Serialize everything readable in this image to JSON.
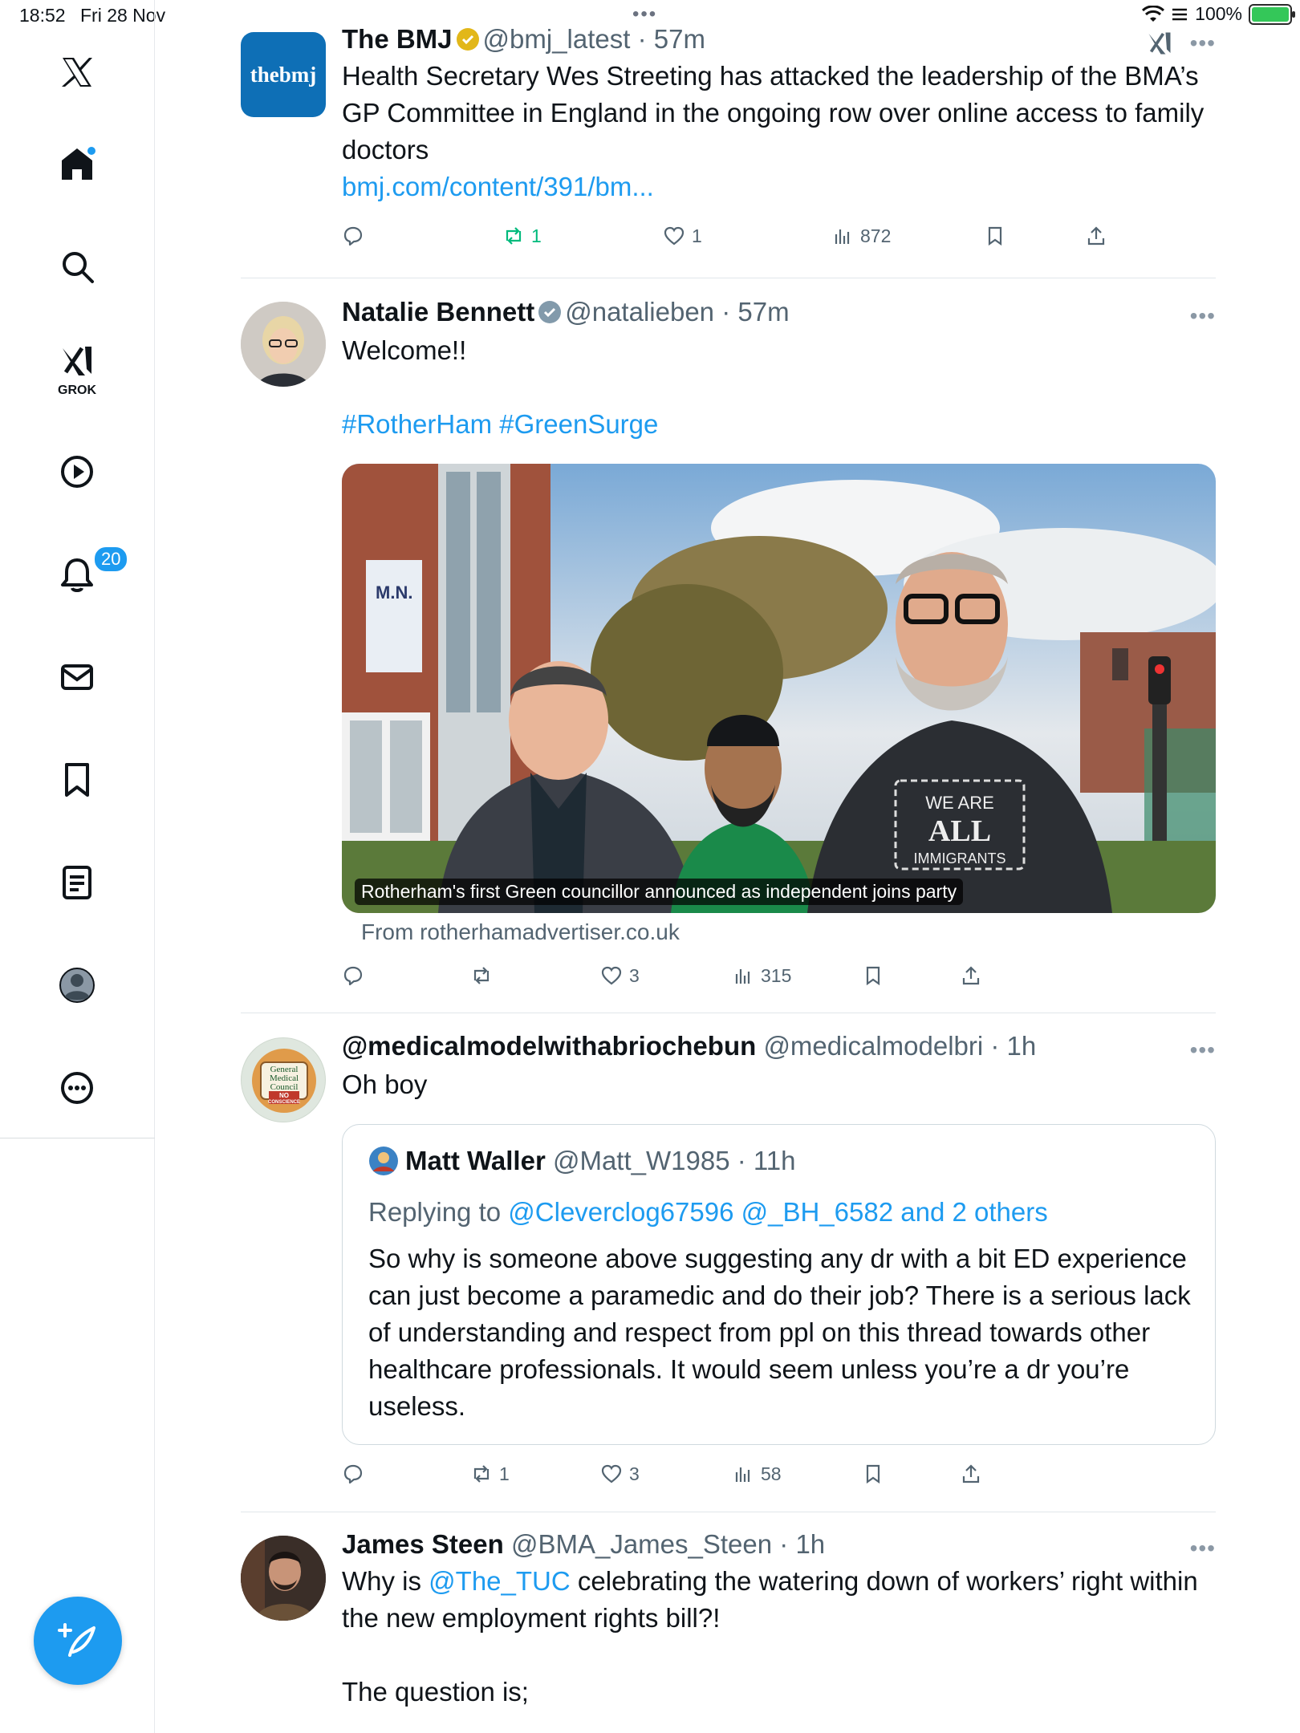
{
  "status_bar": {
    "time": "18:52",
    "date": "Fri 28 Nov",
    "battery": "100%"
  },
  "sidebar": {
    "items": [
      {
        "icon": "x-logo-icon"
      },
      {
        "icon": "home-icon"
      },
      {
        "icon": "search-icon"
      },
      {
        "icon": "grok-icon",
        "label": "GROK"
      },
      {
        "icon": "video-icon"
      },
      {
        "icon": "notifications-icon",
        "badge": "20"
      },
      {
        "icon": "messages-icon"
      },
      {
        "icon": "bookmarks-icon"
      },
      {
        "icon": "lists-icon"
      },
      {
        "icon": "profile-icon"
      },
      {
        "icon": "more-icon"
      }
    ],
    "compose_icon": "compose-icon"
  },
  "colors": {
    "accent": "#1d9bf0",
    "retweet_green": "#00ba7c",
    "secondary_text": "#536471"
  },
  "tweets": [
    {
      "name": "The BMJ",
      "handle": "@bmj_latest",
      "time": "57m",
      "verified": "gold",
      "avatar_text": "thebmj",
      "text": "Health Secretary Wes Streeting has attacked the leadership of the BMA’s GP Committee in England in the ongoing row over online access to family doctors",
      "link": "bmj.com/content/391/bm...",
      "retweets": "1",
      "likes": "1",
      "views": "872"
    },
    {
      "name": "Natalie Bennett",
      "handle": "@natalieben",
      "time": "57m",
      "verified": "grey",
      "text": "Welcome!!",
      "hashtags": "#RotherHam #GreenSurge",
      "card_caption": "Rotherham's first Green councillor announced as independent joins party",
      "card_shirt": "WE ARE",
      "card_shirt_big": "ALL",
      "card_shirt_small": "IMMIGRANTS",
      "card_sign": "M.N.",
      "card_source": "From rotherhamadvertiser.co.uk",
      "likes": "3",
      "views": "315"
    },
    {
      "name": "@medicalmodelwithabriochebun",
      "handle": "@medicalmodelbri",
      "time": "1h",
      "avatar_lines": [
        "General",
        "Medical",
        "Council",
        "NO",
        "CONSCIENCE"
      ],
      "text": "Oh boy",
      "quote": {
        "name": "Matt Waller",
        "handle": "@Matt_W1985",
        "time": "11h",
        "replying_prefix": "Replying to",
        "replying_to": "@Cleverclog67596 @_BH_6582 and 2 others",
        "text": "So why is someone above suggesting any dr with a bit ED experience can just become a paramedic and do their job? There is a serious lack of understanding and respect from ppl on this thread towards other healthcare professionals. It would seem unless you’re a dr you’re useless."
      },
      "retweets": "1",
      "likes": "3",
      "views": "58"
    },
    {
      "name": "James Steen",
      "handle": "@BMA_James_Steen",
      "time": "1h",
      "text_prefix": "Why is",
      "mention": "@The_TUC",
      "text_suffix": "celebrating the watering down of workers’ right within the new employment rights bill?!",
      "text2": "The question is;"
    }
  ]
}
